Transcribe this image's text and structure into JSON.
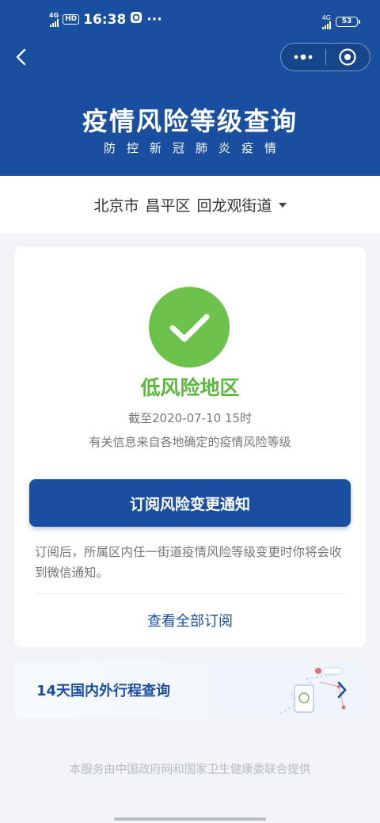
{
  "status_bar": {
    "network_left": "4G",
    "hd": "HD",
    "time": "16:38",
    "dots": "···",
    "network_right": "4G",
    "battery": "53"
  },
  "header": {
    "title": "疫情风险等级查询",
    "subtitle": "防控新冠肺炎疫情"
  },
  "location": {
    "city": "北京市",
    "district": "昌平区",
    "street": "回龙观街道"
  },
  "risk_card": {
    "level": "低风险地区",
    "as_of": "截至2020-07-10 15时",
    "source_note": "有关信息来自各地确定的疫情风险等级",
    "subscribe_label": "订阅风险变更通知",
    "subscribe_desc": "订阅后，所属区内任一街道疫情风险等级变更时你将会收到微信通知。",
    "view_all_label": "查看全部订阅"
  },
  "travel": {
    "label": "14天国内外行程查询"
  },
  "footer": {
    "text": "本服务由中国政府网和国家卫生健康委联合提供"
  },
  "colors": {
    "primary": "#1a4fa0",
    "success": "#6cc24a",
    "background": "#f2f4f7"
  }
}
